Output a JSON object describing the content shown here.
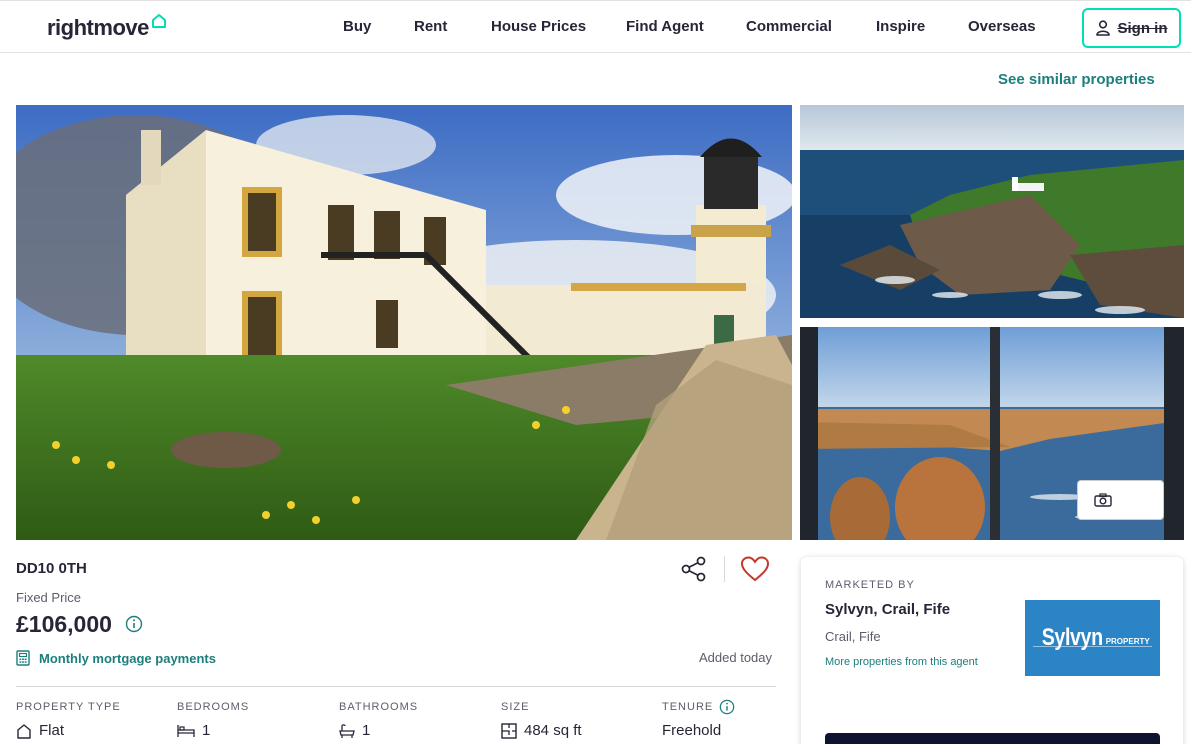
{
  "header": {
    "logo_text": "rightmove",
    "nav": [
      {
        "label": "Buy"
      },
      {
        "label": "Rent"
      },
      {
        "label": "House Prices"
      },
      {
        "label": "Find Agent"
      },
      {
        "label": "Commercial"
      },
      {
        "label": "Inspire"
      },
      {
        "label": "Overseas"
      }
    ],
    "signin_label": "Sign in"
  },
  "see_similar": "See similar properties",
  "gallery": {
    "main_image": "lighthouse-cottage-photo",
    "side_images": [
      "coastal-aerial-photo",
      "sea-view-window-photo"
    ],
    "photo_button_icon": "camera-icon"
  },
  "listing": {
    "postcode": "DD10 0TH",
    "price_qualifier": "Fixed Price",
    "price": "£106,000",
    "mortgage_link": "Monthly mortgage payments",
    "added": "Added today",
    "info": [
      {
        "label": "PROPERTY TYPE",
        "value": "Flat",
        "icon": "house-icon"
      },
      {
        "label": "BEDROOMS",
        "value": "1",
        "icon": "bed-icon"
      },
      {
        "label": "BATHROOMS",
        "value": "1",
        "icon": "bath-icon"
      },
      {
        "label": "SIZE",
        "value": "484 sq ft",
        "icon": "floorplan-icon"
      },
      {
        "label": "TENURE",
        "value": "Freehold",
        "icon": "info-icon"
      }
    ]
  },
  "agent": {
    "marketed_by": "MARKETED BY",
    "name": "Sylvyn, Crail, Fife",
    "location": "Crail, Fife",
    "more_link": "More properties from this agent",
    "logo_text": "Sylvyn",
    "logo_sub": "PROPERTY"
  },
  "colors": {
    "brand_teal": "#1d7e7e",
    "signin_border": "#00deb6",
    "heart_red": "#c4372a",
    "agent_logo_bg": "#2b84c6",
    "contact_button": "#0f1230"
  }
}
